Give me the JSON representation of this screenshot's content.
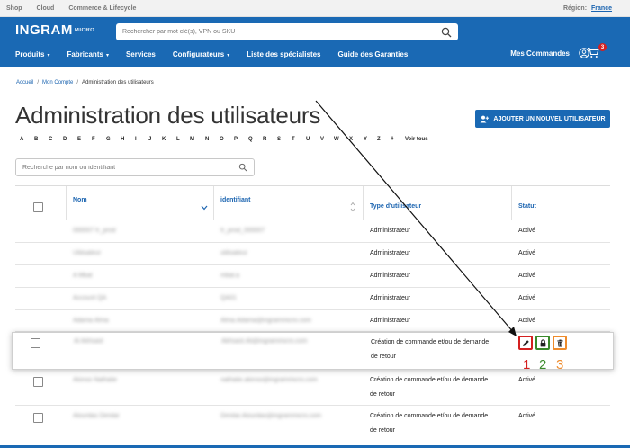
{
  "topbar": {
    "links": [
      "Shop",
      "Cloud",
      "Commerce & Lifecycle"
    ],
    "region_label": "Région:",
    "region_value": "France"
  },
  "header": {
    "logo": "INGRAM",
    "logo_mark": "MICRO",
    "search_placeholder": "Rechercher par mot clé(s), VPN ou SKU",
    "nav": [
      "Produits",
      "Fabricants",
      "Services",
      "Configurateurs",
      "Liste des spécialistes",
      "Guide des Garanties"
    ],
    "my_orders": "Mes Commandes",
    "cart_count": "3"
  },
  "breadcrumb": [
    "Accueil",
    "Mon Compte",
    "Administration des utilisateurs"
  ],
  "page_title": "Administration des utilisateurs",
  "add_button": "AJOUTER UN NOUVEL UTILISATEUR",
  "alphabet": [
    "A",
    "B",
    "C",
    "D",
    "E",
    "F",
    "G",
    "H",
    "I",
    "J",
    "K",
    "L",
    "M",
    "N",
    "O",
    "P",
    "Q",
    "R",
    "S",
    "T",
    "U",
    "V",
    "W",
    "X",
    "Y",
    "Z",
    "#",
    "Voir tous"
  ],
  "filter_placeholder": "Recherche par nom ou identifiant",
  "table": {
    "headers": {
      "name": "Nom",
      "id": "identifiant",
      "type": "Type d'utilisateur",
      "status": "Statut"
    },
    "rows": [
      {
        "name": "000007 fr_prod",
        "id": "fr_prod_000007",
        "type": "Administrateur",
        "status": "Activé"
      },
      {
        "name": "Utilisateur",
        "id": "utilisateur",
        "type": "Administrateur",
        "status": "Activé"
      },
      {
        "name": "A Mbal",
        "id": "mbal.a",
        "type": "Administrateur",
        "status": "Activé"
      },
      {
        "name": "Account QA",
        "id": "QA01",
        "type": "Administrateur",
        "status": "Activé"
      },
      {
        "name": "Adama Alma",
        "id": "Alma.Adama@ingrammicro.com",
        "type": "Administrateur",
        "status": "Activé"
      },
      {
        "name": "Al Akhsast",
        "id": "Akhsast.Ali@ingrammicro.com",
        "type_line1": "Création de commande et/ou de demande",
        "type_line2": "de retour",
        "status": ""
      },
      {
        "name": "Alonso Nathalie",
        "id": "nathalie.alonso@ingrammicro.com",
        "type_line1": "Création de commande et/ou de demande",
        "type_line2": "de retour",
        "status": "Activé"
      },
      {
        "name": "Alourdas Dimitar",
        "id": "Dimitar.Alourdas@ingrammicro.com",
        "type_line1": "Création de commande et/ou de demande",
        "type_line2": "de retour",
        "status": "Activé"
      }
    ]
  },
  "action_labels": [
    "1",
    "2",
    "3"
  ],
  "colors": {
    "brand": "#1a69b4",
    "edit": "#d42020",
    "lock": "#3a8a2b",
    "delete": "#ee8b2c"
  }
}
